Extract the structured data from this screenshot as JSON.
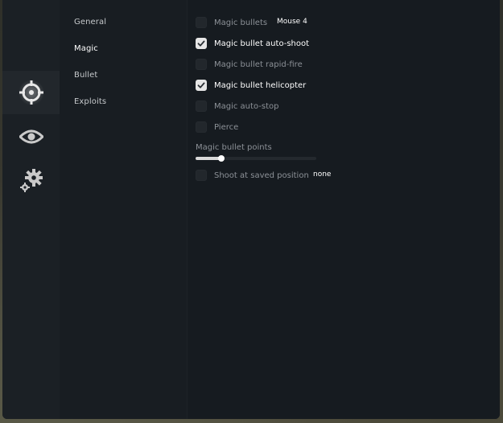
{
  "rail": {
    "items": [
      {
        "icon": "crosshair-icon",
        "active": true
      },
      {
        "icon": "eye-icon",
        "active": false
      },
      {
        "icon": "gears-icon",
        "active": false
      }
    ]
  },
  "subnav": {
    "items": [
      {
        "label": "General",
        "active": false
      },
      {
        "label": "Magic",
        "active": true
      },
      {
        "label": "Bullet",
        "active": false
      },
      {
        "label": "Exploits",
        "active": false
      }
    ]
  },
  "options": {
    "magic_bullets": {
      "label": "Magic bullets",
      "checked": false,
      "keybind": "Mouse 4"
    },
    "auto_shoot": {
      "label": "Magic bullet auto-shoot",
      "checked": true
    },
    "rapid_fire": {
      "label": "Magic bullet rapid-fire",
      "checked": false
    },
    "helicopter": {
      "label": "Magic bullet helicopter",
      "checked": true
    },
    "auto_stop": {
      "label": "Magic auto-stop",
      "checked": false
    },
    "pierce": {
      "label": "Pierce",
      "checked": false
    },
    "saved_position": {
      "label": "Shoot at saved position",
      "checked": false,
      "keybind": "none"
    }
  },
  "slider": {
    "label": "Magic bullet points",
    "fraction": 0.21
  },
  "colors": {
    "panel": "#171c21",
    "checkbox_on": "#e6e6e6",
    "text_dim": "#8c9197",
    "text_on": "#ffffff"
  }
}
